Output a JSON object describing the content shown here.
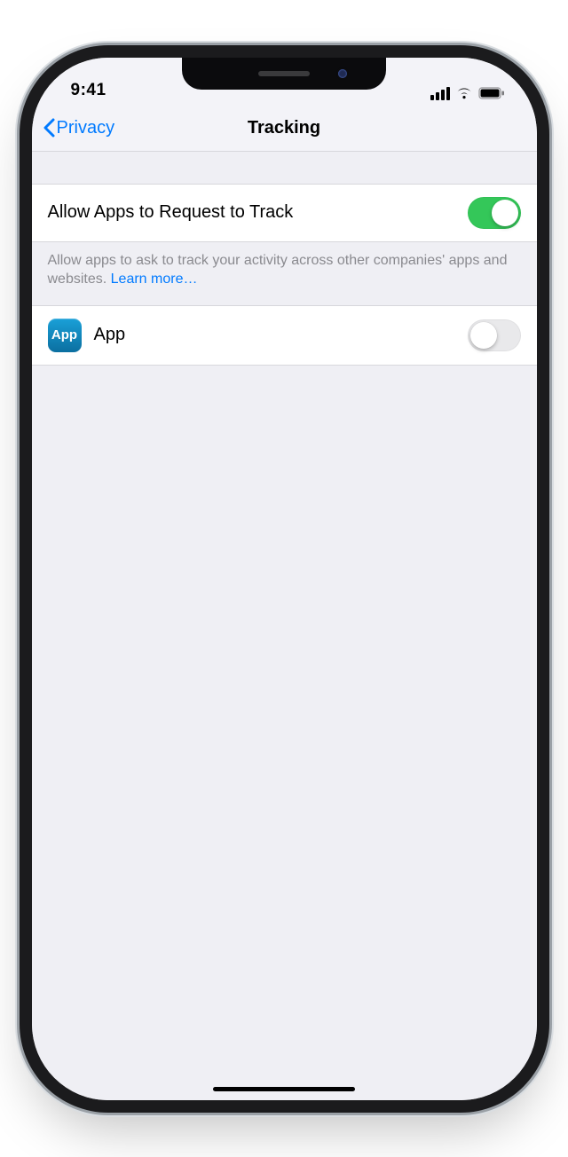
{
  "statusbar": {
    "time": "9:41"
  },
  "nav": {
    "back_label": "Privacy",
    "title": "Tracking"
  },
  "settings": {
    "allow_row": {
      "label": "Allow Apps to Request to Track",
      "enabled": true
    },
    "footer": {
      "text": "Allow apps to ask to track your activity across other companies' apps and websites. ",
      "learn_more": "Learn more…"
    }
  },
  "apps": [
    {
      "icon_label": "App",
      "name": "App",
      "enabled": false
    }
  ]
}
